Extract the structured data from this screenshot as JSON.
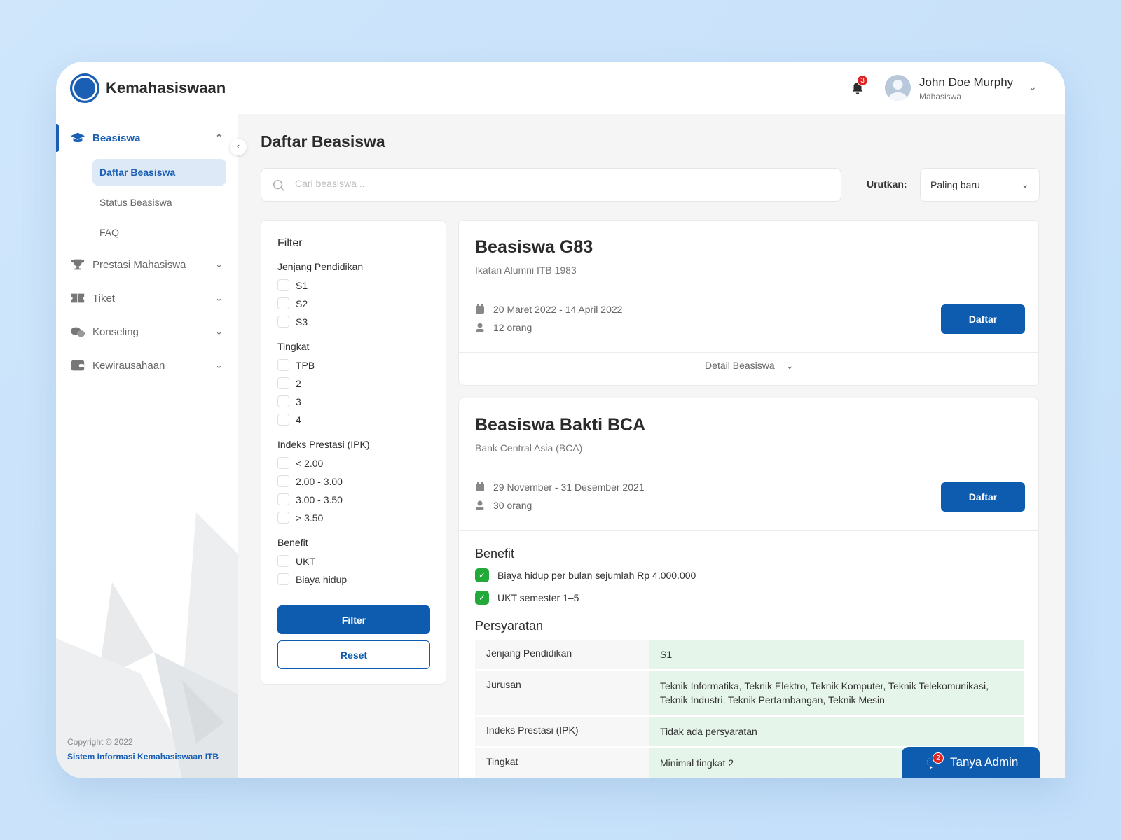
{
  "header": {
    "brand": "Kemahasiswaan",
    "notif_count": "3",
    "user_name": "John Doe Murphy",
    "user_role": "Mahasiswa"
  },
  "sidebar": {
    "items": [
      {
        "label": "Beasiswa",
        "expanded": true,
        "sub": [
          "Daftar Beasiswa",
          "Status Beasiswa",
          "FAQ"
        ]
      },
      {
        "label": "Prestasi Mahasiswa"
      },
      {
        "label": "Tiket"
      },
      {
        "label": "Konseling"
      },
      {
        "label": "Kewirausahaan"
      }
    ],
    "copyright": "Copyright © 2022",
    "footer_link": "Sistem Informasi Kemahasiswaan ITB"
  },
  "main": {
    "title": "Daftar Beasiswa",
    "search_placeholder": "Cari beasiswa ...",
    "sort_label": "Urutkan:",
    "sort_value": "Paling baru",
    "filter": {
      "title": "Filter",
      "groups": [
        {
          "label": "Jenjang Pendidikan",
          "options": [
            "S1",
            "S2",
            "S3"
          ]
        },
        {
          "label": "Tingkat",
          "options": [
            "TPB",
            "2",
            "3",
            "4"
          ]
        },
        {
          "label": "Indeks Prestasi (IPK)",
          "options": [
            "< 2.00",
            "2.00 - 3.00",
            "3.00 - 3.50",
            "> 3.50"
          ]
        },
        {
          "label": "Benefit",
          "options": [
            "UKT",
            "Biaya hidup"
          ]
        }
      ],
      "filter_button": "Filter",
      "reset_button": "Reset"
    },
    "scholarships": [
      {
        "title": "Beasiswa G83",
        "provider": "Ikatan Alumni ITB 1983",
        "dates": "20 Maret 2022 - 14 April 2022",
        "quota": "12 orang",
        "button": "Daftar",
        "detail_label": "Detail Beasiswa"
      },
      {
        "title": "Beasiswa Bakti BCA",
        "provider": "Bank Central Asia (BCA)",
        "dates": "29 November - 31 Desember 2021",
        "quota": "30 orang",
        "button": "Daftar",
        "benefit_title": "Benefit",
        "benefits": [
          "Biaya hidup per bulan sejumlah Rp 4.000.000",
          "UKT semester 1–5"
        ],
        "req_title": "Persyaratan",
        "requirements": [
          {
            "key": "Jenjang Pendidikan",
            "value": "S1"
          },
          {
            "key": "Jurusan",
            "value": "Teknik Informatika, Teknik Elektro, Teknik Komputer, Teknik Telekomunikasi, Teknik Industri, Teknik Pertambangan, Teknik Mesin"
          },
          {
            "key": "Indeks Prestasi (IPK)",
            "value": "Tidak ada persyaratan"
          },
          {
            "key": "Tingkat",
            "value": "Minimal tingkat 2"
          }
        ]
      }
    ]
  },
  "chat": {
    "label": "Tanya Admin",
    "count": "2"
  },
  "colors": {
    "primary": "#0d5cb0",
    "success": "#22a93a",
    "badge": "#e02424"
  }
}
